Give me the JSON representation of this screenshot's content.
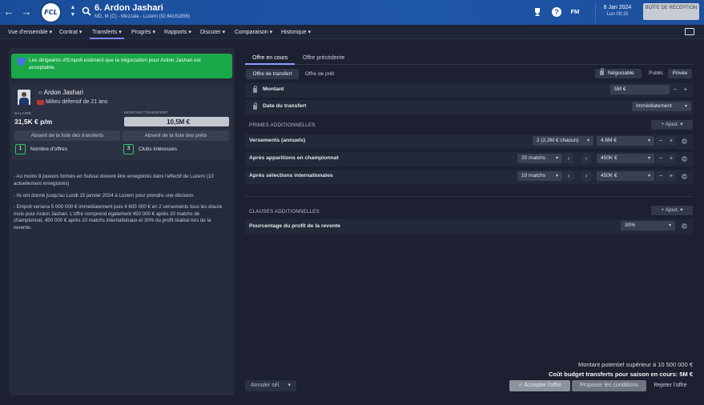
{
  "header": {
    "back_icon": "arrow-left-icon",
    "forward_icon": "arrow-right-icon",
    "club_crest": "FCL",
    "player_title": "6. Ardon Jashari",
    "player_subtitle": "MD, M (C) - Mezzala - Luzern (ID 84161856)",
    "fm_label": "FM",
    "help_label": "?",
    "date": "8 Jan 2024",
    "time": "Lun 09:15",
    "inbox_label": "BOÎTE DE RÉCEPTION"
  },
  "menu": {
    "items": [
      "Vue d'ensemble",
      "Contrat",
      "Transferts",
      "Progrès",
      "Rapports",
      "Discuter",
      "Comparaison",
      "Historique"
    ],
    "active": "Transferts"
  },
  "alert": {
    "text": "Les dirigeants d'Empoli estiment que la négociation pour Ardon Jashari est acceptable."
  },
  "player": {
    "name": "Ardon Jashari",
    "position": "Milieu défensif de 21 ans",
    "salary_label": "SALAIRE",
    "salary": "31,5K € p/m",
    "transfer_value_label": "MONTANT TRANSFERT",
    "transfer_value": "10,5M €",
    "transfer_list_btn": "Absent de la liste des transferts",
    "loan_list_btn": "Absent de la liste des prêts",
    "offers_count": "1",
    "offers_label": "Nombre d'offres",
    "clubs_count": "3",
    "clubs_label": "Clubs intéressés"
  },
  "notes": [
    "- Au moins 8 joueurs formés en Suisse doivent être enregistrés dans l'effectif de Luzern (10 actuellement enregistrés)",
    "- Ils ont donné jusqu'au Lundi 15 janvier 2024 à Luzern pour prendre une décision.",
    "- Empoli versera 5 000 000 € immédiatement puis 4 600 000 € en 2 versements tous les douze mois pour Ardon Jashari. L'offre comprend également 450 000 € après 20 matchs de championnat, 450 000 € après 10 matchs internationaux et 30% du profit réalisé lors de la revente."
  ],
  "offer": {
    "tabs": [
      "Offre en cours",
      "Offre précédente"
    ],
    "subtabs": [
      "Offre de transfert",
      "Offre de prêt"
    ],
    "negotiable_label": "Négociable",
    "visibility": [
      "Public",
      "Privée"
    ],
    "amount_label": "Montant",
    "amount_value": "5M €",
    "date_label": "Date du transfert",
    "date_value": "Immédiatement",
    "bonuses_title": "PRIMES ADDITIONNELLES",
    "add_label": "Ajout.",
    "bonuses": [
      {
        "label": "Versements (annuels)",
        "option": "2 (2,3M € chacun)",
        "value": "4,6M €"
      },
      {
        "label": "Après apparitions en championnat",
        "option": "20 matchs",
        "value": "450K €"
      },
      {
        "label": "Après sélections internationales",
        "option": "10 matchs",
        "value": "450K €"
      }
    ],
    "clauses_title": "CLAUSES ADDITIONNELLES",
    "clauses": [
      {
        "label": "Pourcentage du profit de la revente",
        "value": "30%"
      }
    ]
  },
  "footer": {
    "potential": "Montant potentiel supérieur à 10 500 000 €",
    "budget": "Coût budget transferts pour saison en cours: 5M €",
    "cancel_select": "Annuler sél.",
    "accept": "Accepter l'offre",
    "propose": "Proposer les conditions",
    "reject": "Rejeter l'offre"
  }
}
